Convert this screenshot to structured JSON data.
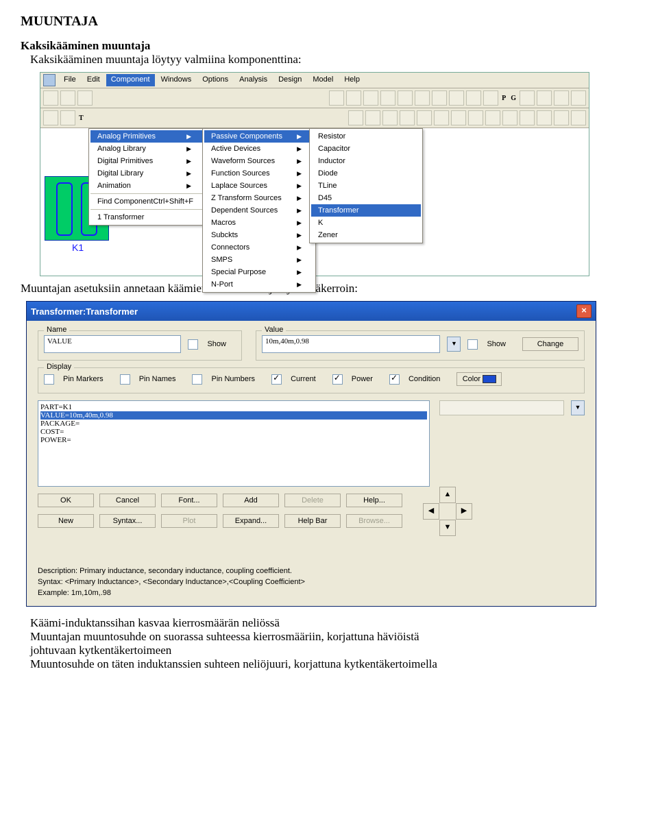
{
  "doc": {
    "title": "MUUNTAJA",
    "h2": "Kaksikääminen muuntaja",
    "p1": "Kaksikääminen muuntaja löytyy valmiina komponenttina:",
    "p2": "Muuntajan asetuksiin annetaan käämien induktanssit ja kytkentäkerroin:",
    "p3a": "Käämi-induktanssihan kasvaa kierrosmäärän neliössä",
    "p3b": "Muuntajan muuntosuhde on suorassa suhteessa kierrosmääriin, korjattuna häviöistä",
    "p3c": " johtuvaan kytkentäkertoimeen",
    "p3d": "Muuntosuhde on täten induktanssien suhteen neliöjuuri, korjattuna kytkentäkertoimella"
  },
  "menubar": [
    "File",
    "Edit",
    "Component",
    "Windows",
    "Options",
    "Analysis",
    "Design",
    "Model",
    "Help"
  ],
  "menu1": {
    "items": [
      "Analog Primitives",
      "Analog Library",
      "Digital Primitives",
      "Digital Library",
      "Animation"
    ],
    "find": "Find Component",
    "find_shortcut": "Ctrl+Shift+F",
    "recent": "1 Transformer",
    "selected_index": 0
  },
  "menu2": {
    "items": [
      "Passive Components",
      "Active Devices",
      "Waveform Sources",
      "Function Sources",
      "Laplace Sources",
      "Z Transform Sources",
      "Dependent Sources",
      "Macros",
      "Subckts",
      "Connectors",
      "SMPS",
      "Special Purpose",
      "N-Port"
    ],
    "selected_index": 0
  },
  "menu3": {
    "items": [
      "Resistor",
      "Capacitor",
      "Inductor",
      "Diode",
      "TLine",
      "D45",
      "Transformer",
      "K",
      "Zener"
    ],
    "selected_index": 6
  },
  "canvas": {
    "caption": "K1"
  },
  "dialog": {
    "title": "Transformer:Transformer",
    "name_legend": "Name",
    "name_value": "VALUE",
    "value_legend": "Value",
    "value_value": "10m,40m,0.98",
    "show_label": "Show",
    "change_btn": "Change",
    "display_legend": "Display",
    "pin_markers": "Pin Markers",
    "pin_names": "Pin Names",
    "pin_numbers": "Pin Numbers",
    "current": "Current",
    "power": "Power",
    "condition": "Condition",
    "color_btn": "Color",
    "list": [
      "PART=K1",
      "VALUE=10m,40m,0.98",
      "PACKAGE=",
      "COST=",
      "POWER="
    ],
    "list_selected": 1,
    "buttons1": [
      "OK",
      "Cancel",
      "Font...",
      "Add",
      "Delete",
      "Help..."
    ],
    "buttons2": [
      "New",
      "Syntax...",
      "Plot",
      "Expand...",
      "Help Bar",
      "Browse..."
    ],
    "disabled_btns": [
      "Delete",
      "Plot",
      "Browse..."
    ],
    "desc1": "Description: Primary inductance, secondary inductance, coupling coefficient.",
    "desc2": "Syntax: <Primary Inductance>, <Secondary Inductance>,<Coupling Coefficient>",
    "desc3": "Example: 1m,10m,.98"
  }
}
